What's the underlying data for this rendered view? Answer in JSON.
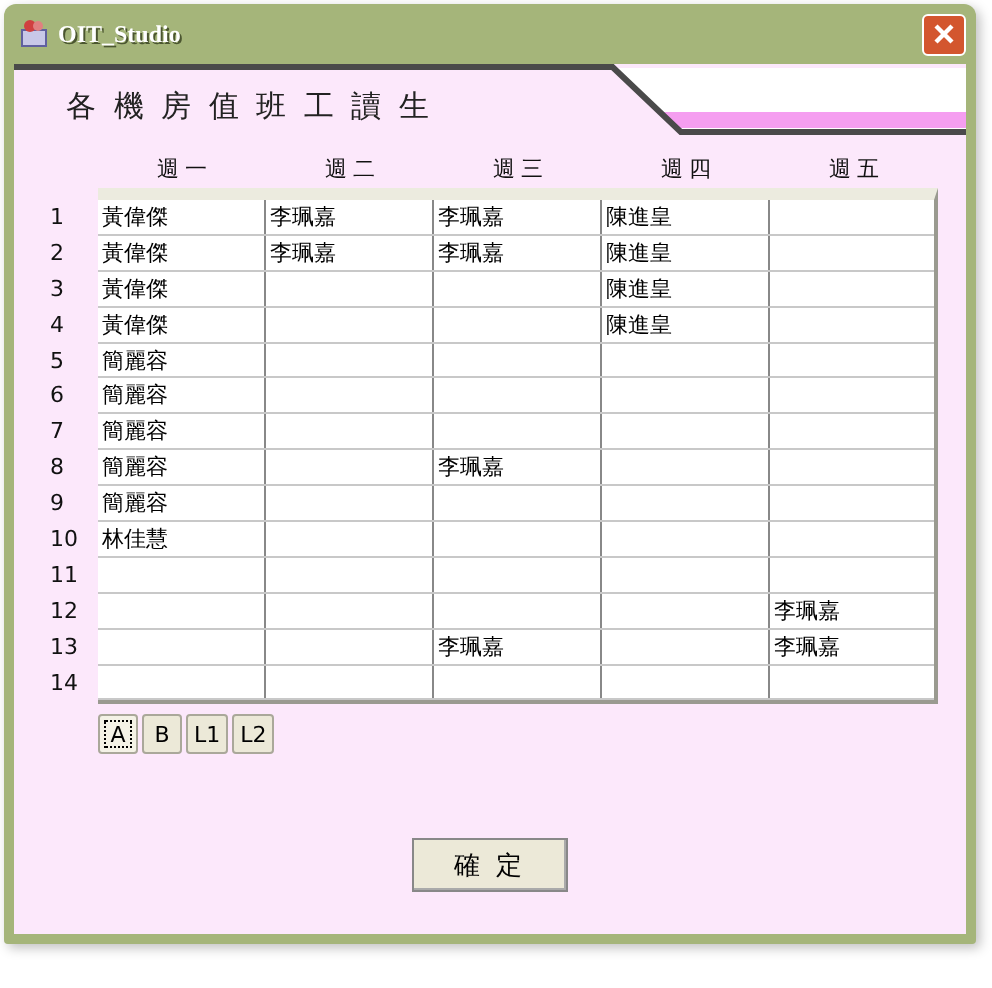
{
  "window": {
    "title": "OIT_Studio"
  },
  "heading": "各 機 房 值 班 工 讀 生",
  "columns": [
    "週 一",
    "週 二",
    "週 三",
    "週 四",
    "週 五"
  ],
  "rows": [
    {
      "number": "1",
      "cells": [
        "黃偉傑",
        "李珮嘉",
        "李珮嘉",
        "陳進皇",
        null
      ]
    },
    {
      "number": "2",
      "cells": [
        "黃偉傑",
        "李珮嘉",
        "李珮嘉",
        "陳進皇",
        null
      ]
    },
    {
      "number": "3",
      "cells": [
        "黃偉傑",
        null,
        null,
        "陳進皇",
        null
      ]
    },
    {
      "number": "4",
      "cells": [
        "黃偉傑",
        null,
        null,
        "陳進皇",
        null
      ]
    },
    {
      "number": "5",
      "cells": [
        "簡麗容",
        null,
        null,
        null,
        null
      ]
    },
    {
      "number": "6",
      "cells": [
        "簡麗容",
        null,
        null,
        null,
        null
      ]
    },
    {
      "number": "7",
      "cells": [
        "簡麗容",
        null,
        null,
        null,
        null
      ]
    },
    {
      "number": "8",
      "cells": [
        "簡麗容",
        null,
        "李珮嘉",
        null,
        null
      ]
    },
    {
      "number": "9",
      "cells": [
        "簡麗容",
        null,
        null,
        null,
        null
      ]
    },
    {
      "number": "10",
      "cells": [
        "林佳慧",
        null,
        null,
        null,
        null
      ]
    },
    {
      "number": "11",
      "cells": [
        null,
        null,
        null,
        null,
        null
      ]
    },
    {
      "number": "12",
      "cells": [
        null,
        null,
        null,
        null,
        "李珮嘉"
      ]
    },
    {
      "number": "13",
      "cells": [
        null,
        null,
        "李珮嘉",
        null,
        "李珮嘉"
      ]
    },
    {
      "number": "14",
      "cells": [
        null,
        null,
        null,
        null,
        null
      ]
    }
  ],
  "tabs": [
    {
      "label": "A",
      "selected": true
    },
    {
      "label": "B",
      "selected": false
    },
    {
      "label": "L1",
      "selected": false
    },
    {
      "label": "L2",
      "selected": false
    }
  ],
  "button": "確 定"
}
